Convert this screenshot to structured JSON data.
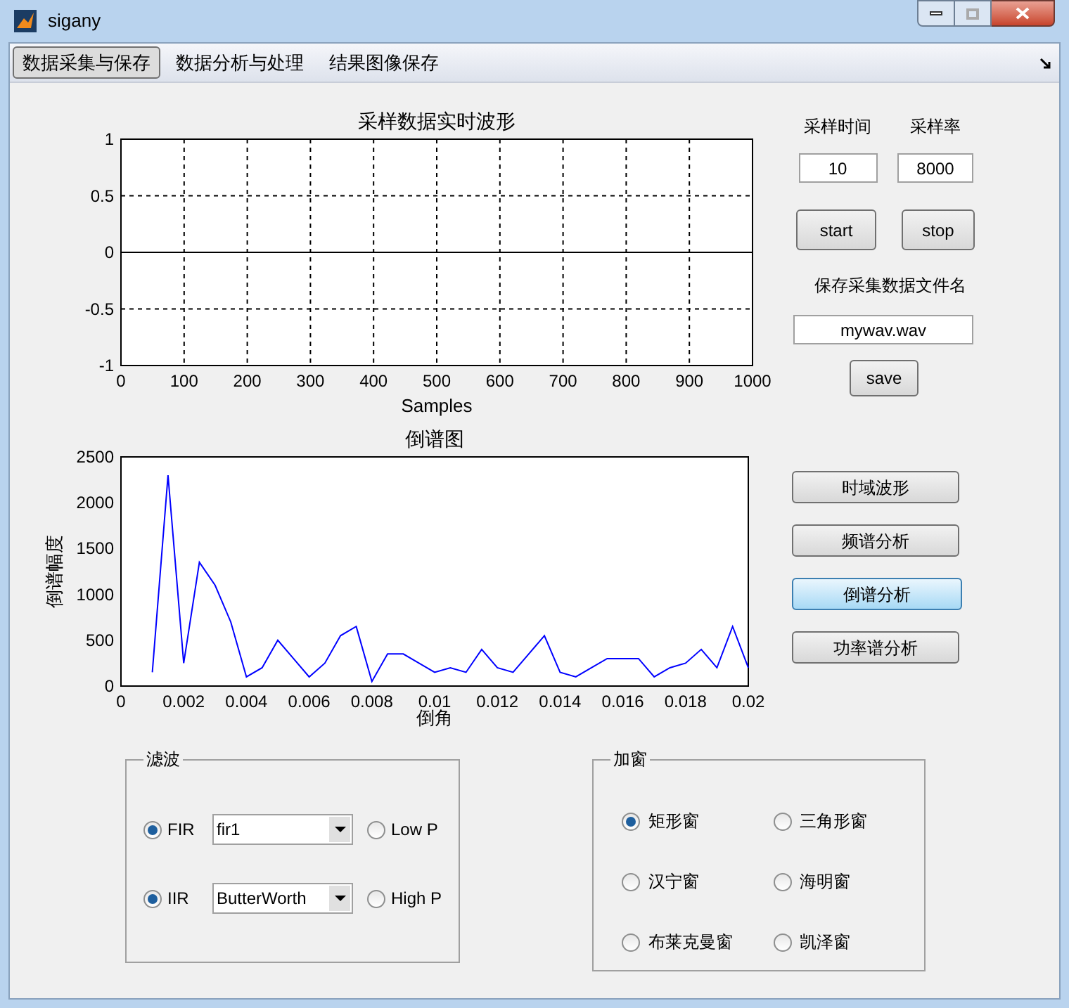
{
  "window": {
    "title": "sigany"
  },
  "menu": [
    {
      "label": "数据采集与保存",
      "selected": true
    },
    {
      "label": "数据分析与处理",
      "selected": false
    },
    {
      "label": "结果图像保存",
      "selected": false
    }
  ],
  "waveform_chart": {
    "grid": true,
    "chart_data": {
      "type": "line",
      "title": "采样数据实时波形",
      "xlabel": "Samples",
      "x": [
        0,
        1000
      ],
      "series": [
        {
          "color": "#000000",
          "values": [
            0,
            0
          ]
        }
      ],
      "xlim": [
        0,
        1000
      ],
      "ylim": [
        -1,
        1
      ],
      "xticks": [
        0,
        100,
        200,
        300,
        400,
        500,
        600,
        700,
        800,
        900,
        1000
      ],
      "yticks": [
        -1,
        -0.5,
        0,
        0.5,
        1
      ]
    }
  },
  "cepstrum_chart": {
    "chart_data": {
      "type": "line",
      "title": "倒谱图",
      "xlabel": "倒角",
      "ylabel": "倒谱幅度",
      "x": [
        0.001,
        0.0015,
        0.002,
        0.0025,
        0.003,
        0.0035,
        0.004,
        0.0045,
        0.005,
        0.0055,
        0.006,
        0.0065,
        0.007,
        0.0075,
        0.008,
        0.0085,
        0.009,
        0.0095,
        0.01,
        0.0105,
        0.011,
        0.0115,
        0.012,
        0.0125,
        0.013,
        0.0135,
        0.014,
        0.0145,
        0.015,
        0.0155,
        0.016,
        0.0165,
        0.017,
        0.0175,
        0.018,
        0.0185,
        0.019,
        0.0195,
        0.02
      ],
      "series": [
        {
          "color": "#0000ff",
          "values": [
            150,
            2300,
            250,
            1350,
            1100,
            700,
            100,
            200,
            500,
            300,
            100,
            250,
            550,
            650,
            50,
            350,
            350,
            250,
            150,
            200,
            150,
            400,
            200,
            150,
            350,
            550,
            150,
            100,
            200,
            300,
            300,
            300,
            100,
            200,
            250,
            400,
            200,
            650,
            200
          ]
        }
      ],
      "xlim": [
        0,
        0.02
      ],
      "ylim": [
        0,
        2500
      ],
      "xticks": [
        0,
        0.002,
        0.004,
        0.006,
        0.008,
        0.01,
        0.012,
        0.014,
        0.016,
        0.018,
        0.02
      ],
      "yticks": [
        0,
        500,
        1000,
        1500,
        2000,
        2500
      ]
    }
  },
  "sampling": {
    "time_label": "采样时间",
    "rate_label": "采样率",
    "time_value": "10",
    "rate_value": "8000",
    "start_button": "start",
    "stop_button": "stop",
    "filename_label": "保存采集数据文件名",
    "filename_value": "mywav.wav",
    "save_button": "save"
  },
  "analysis_buttons": [
    {
      "label": "时域波形",
      "selected": false
    },
    {
      "label": "频谱分析",
      "selected": false
    },
    {
      "label": "倒谱分析",
      "selected": true
    },
    {
      "label": "功率谱分析",
      "selected": false
    }
  ],
  "filter_group": {
    "title": "滤波",
    "rows": [
      {
        "label": "FIR",
        "checked": true,
        "select_value": "fir1",
        "option_label": "Low P",
        "option_checked": false
      },
      {
        "label": "IIR",
        "checked": true,
        "select_value": "ButterWorth",
        "option_label": "High P",
        "option_checked": false
      }
    ]
  },
  "window_group": {
    "title": "加窗",
    "options": [
      {
        "label": "矩形窗",
        "selected": true
      },
      {
        "label": "三角形窗",
        "selected": false
      },
      {
        "label": "汉宁窗",
        "selected": false
      },
      {
        "label": "海明窗",
        "selected": false
      },
      {
        "label": "布莱克曼窗",
        "selected": false
      },
      {
        "label": "凯泽窗",
        "selected": false
      }
    ]
  }
}
